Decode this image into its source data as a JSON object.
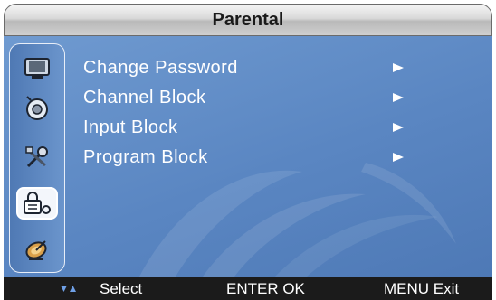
{
  "header": {
    "title": "Parental"
  },
  "sidebar": {
    "icons": [
      {
        "name": "picture-icon",
        "active": false
      },
      {
        "name": "sound-icon",
        "active": false
      },
      {
        "name": "setup-icon",
        "active": false
      },
      {
        "name": "parental-lock-icon",
        "active": true
      },
      {
        "name": "channel-icon",
        "active": false
      }
    ]
  },
  "menu": {
    "items": [
      {
        "label": "Change Password"
      },
      {
        "label": "Channel Block"
      },
      {
        "label": "Input Block"
      },
      {
        "label": "Program Block"
      }
    ]
  },
  "footer": {
    "select_label": "Select",
    "enter_label": "ENTER OK",
    "menu_label": "MENU Exit"
  },
  "colors": {
    "panel_blue": "#5a86c2",
    "footer_bg": "#1b1b1b",
    "text": "#ffffff"
  }
}
